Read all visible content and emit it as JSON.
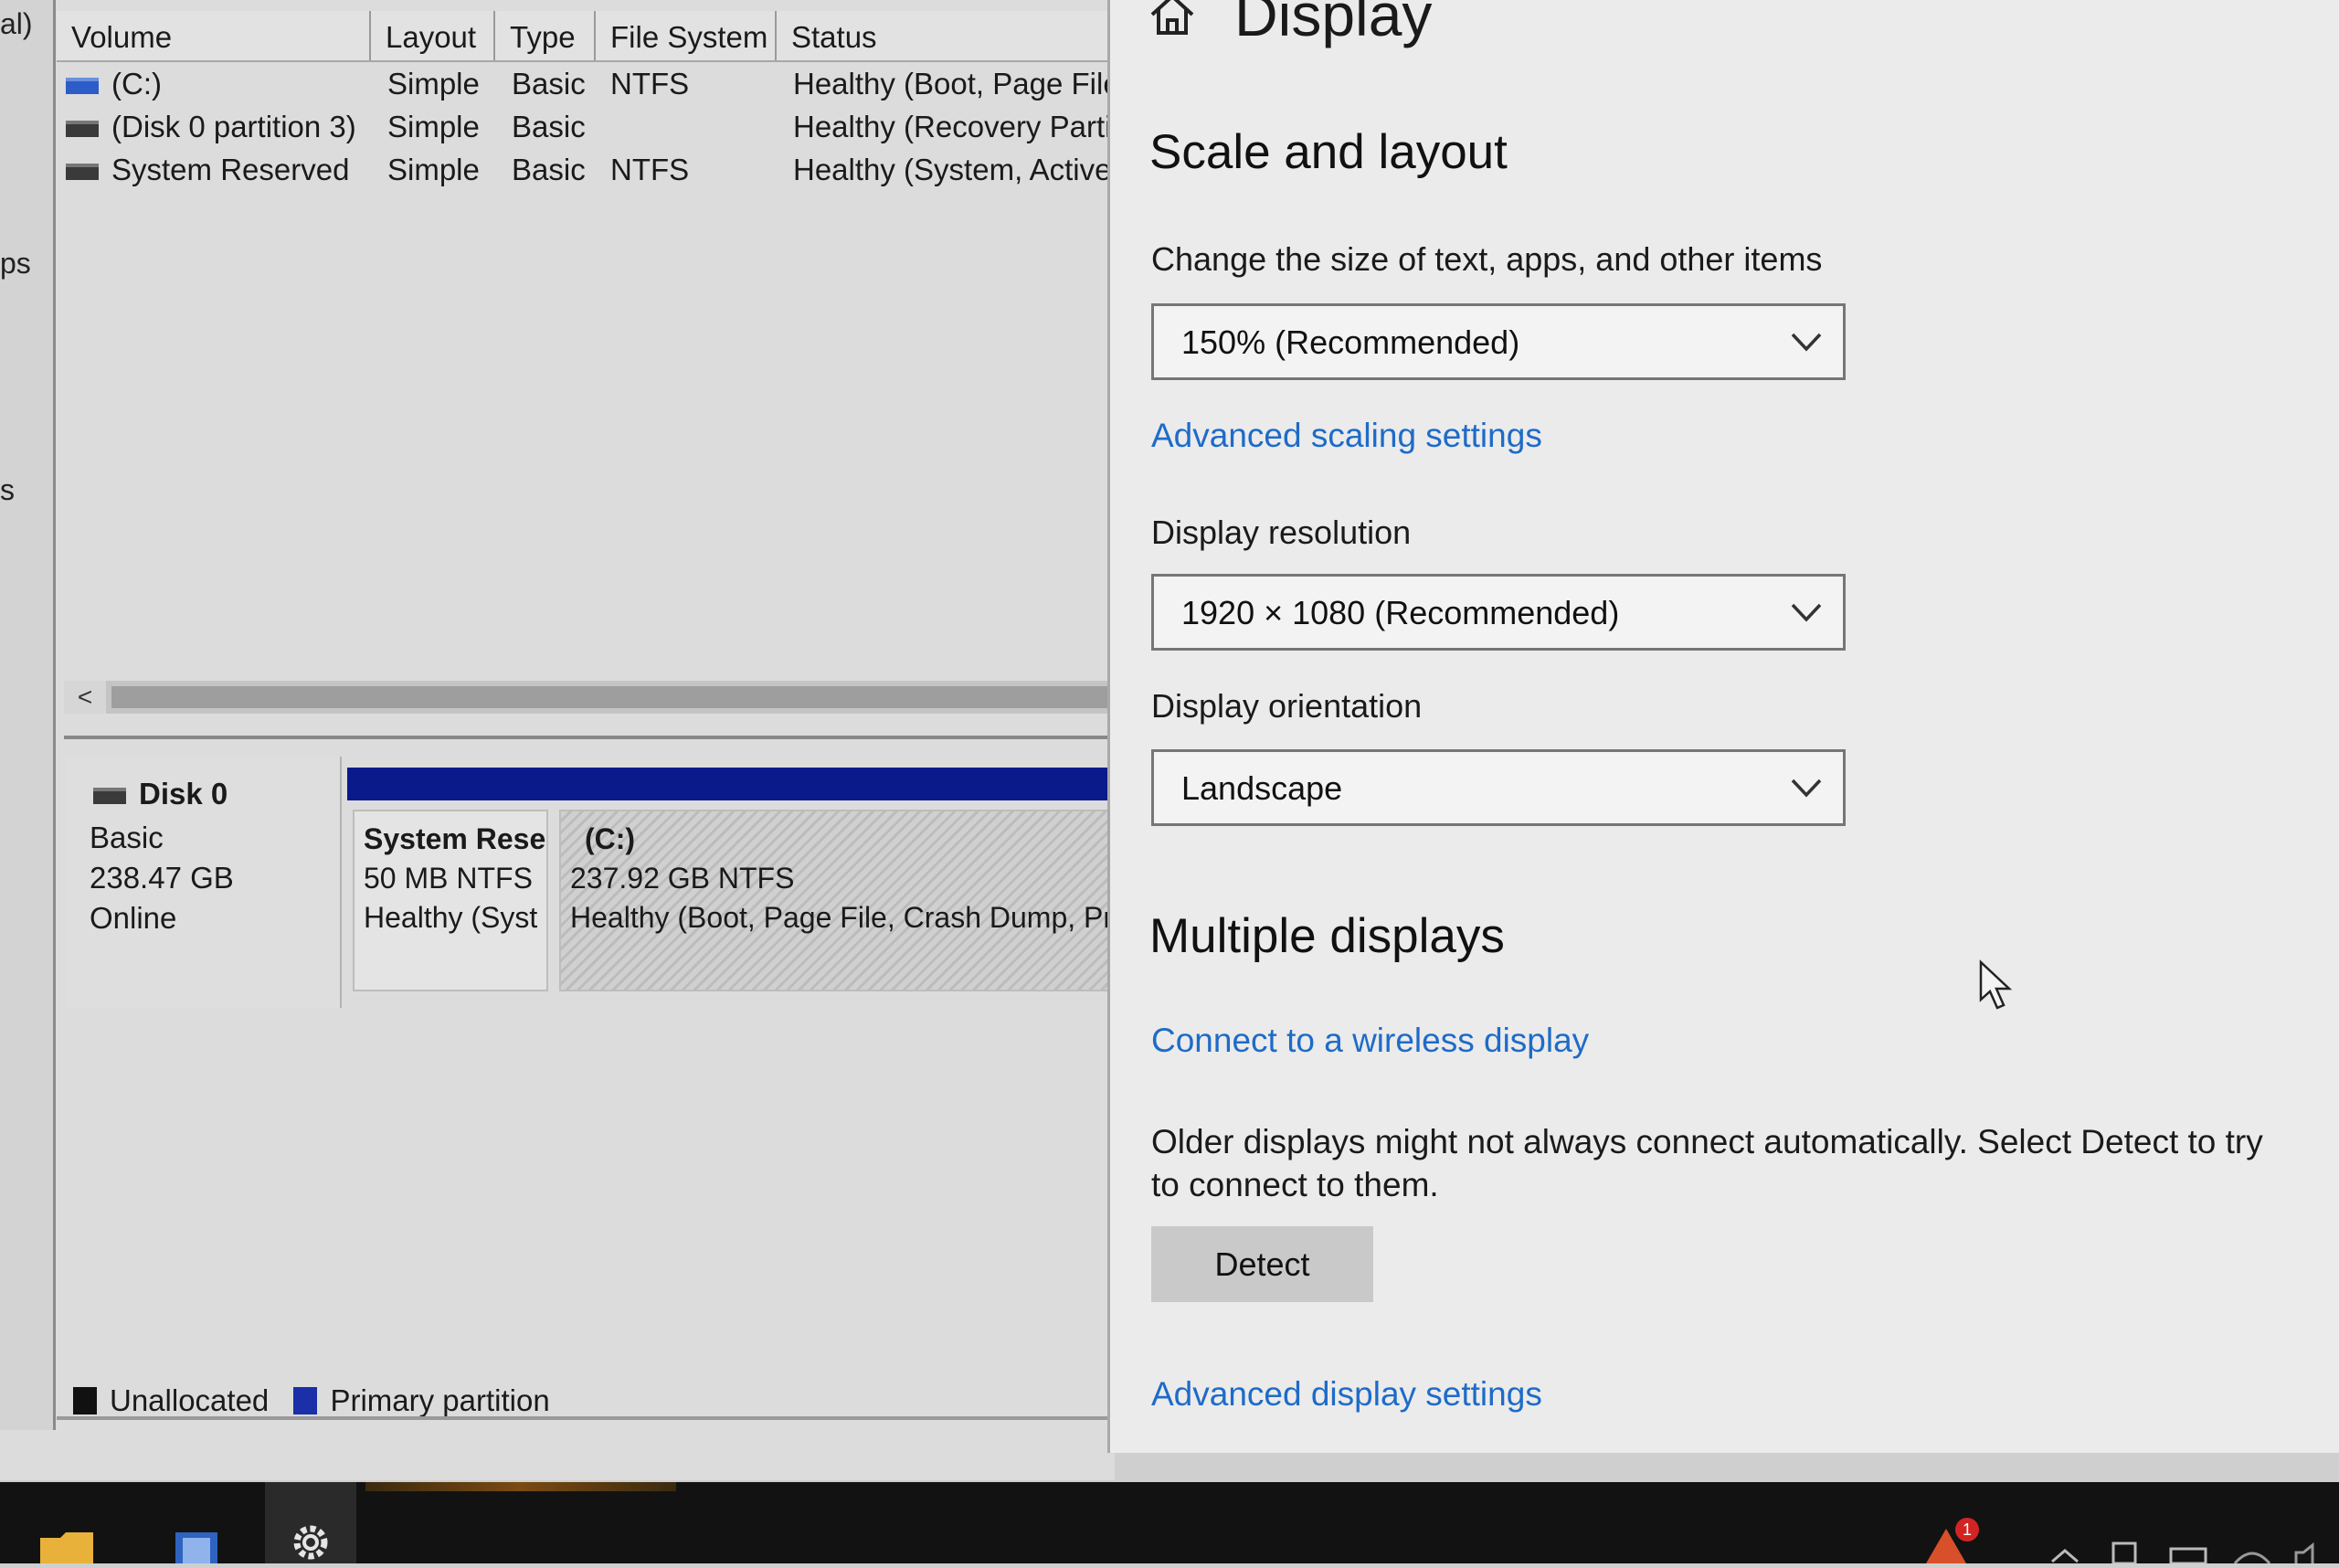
{
  "disk_mgmt": {
    "left_strip": [
      "al)",
      "ps",
      "s"
    ],
    "columns": [
      "Volume",
      "Layout",
      "Type",
      "File System",
      "Status"
    ],
    "rows": [
      {
        "volume": "(C:)",
        "layout": "Simple",
        "type": "Basic",
        "fs": "NTFS",
        "status": "Healthy (Boot, Page File"
      },
      {
        "volume": "(Disk 0 partition 3)",
        "layout": "Simple",
        "type": "Basic",
        "fs": "",
        "status": "Healthy (Recovery Partit"
      },
      {
        "volume": "System Reserved",
        "layout": "Simple",
        "type": "Basic",
        "fs": "NTFS",
        "status": "Healthy (System, Active,"
      }
    ],
    "scroll_left": "<",
    "disk": {
      "name": "Disk 0",
      "type": "Basic",
      "size": "238.47 GB",
      "state": "Online"
    },
    "partitions": [
      {
        "name": "System Rese",
        "size": "50 MB NTFS",
        "status": "Healthy (Syst"
      },
      {
        "name": "(C:)",
        "size": "237.92 GB NTFS",
        "status": "Healthy (Boot, Page File, Crash Dump, Pr"
      }
    ],
    "legend": {
      "unallocated": "Unallocated",
      "primary": "Primary partition",
      "unallocated_color": "#111111",
      "primary_color": "#1a2fa8"
    }
  },
  "settings": {
    "title": "Display",
    "scale_heading": "Scale and layout",
    "scale_label": "Change the size of text, apps, and other items",
    "scale_value": "150% (Recommended)",
    "advanced_scaling": "Advanced scaling settings",
    "resolution_label": "Display resolution",
    "resolution_value": "1920 × 1080 (Recommended)",
    "orientation_label": "Display orientation",
    "orientation_value": "Landscape",
    "multiple_heading": "Multiple displays",
    "wireless_link": "Connect to a wireless display",
    "older_text": "Older displays might not always connect automatically. Select Detect to try to connect to them.",
    "detect_button": "Detect",
    "advanced_display": "Advanced display settings",
    "link_color": "#1e6bc8"
  },
  "taskbar": {
    "notification_badge": "1"
  }
}
